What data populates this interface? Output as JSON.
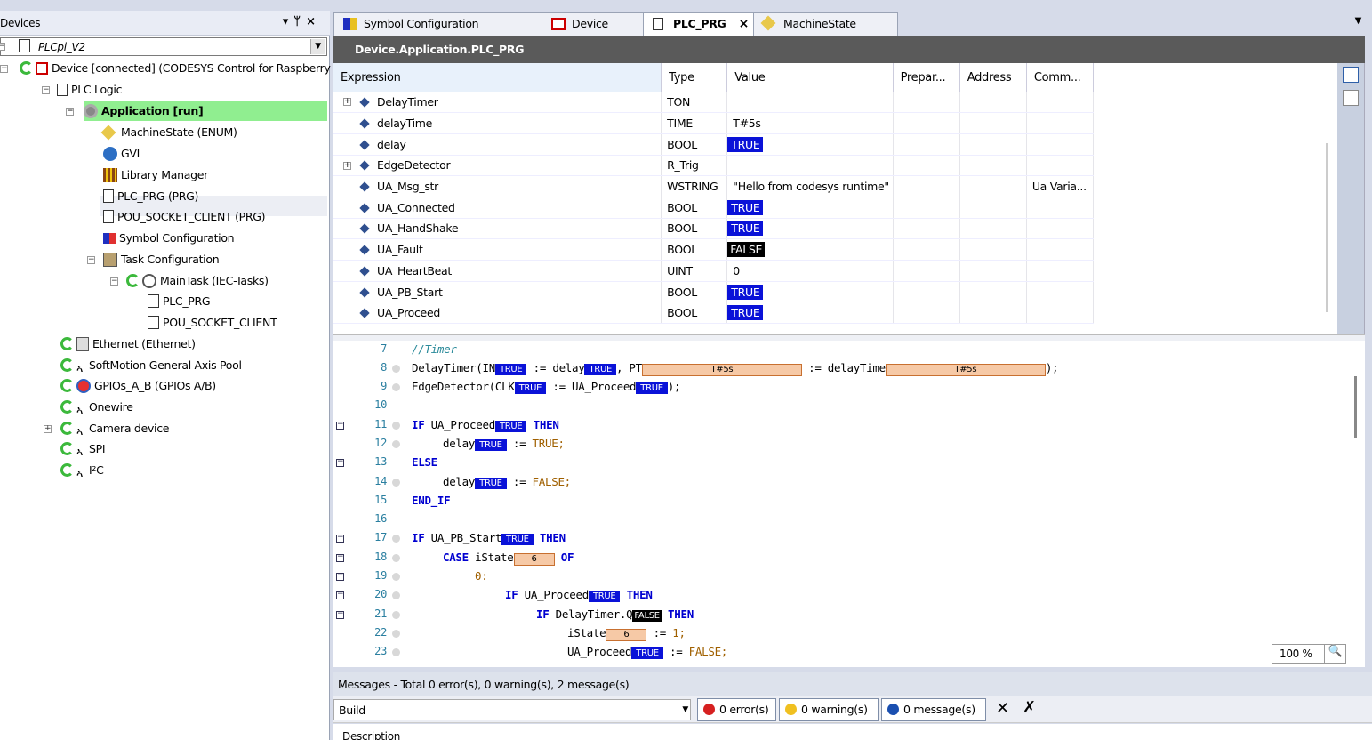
{
  "devices_panel": {
    "title": "Devices",
    "header_buttons": [
      "▾",
      "ᛘ",
      "×"
    ],
    "project_combo": "PLCpi_V2",
    "tree": [
      {
        "label": "Device [connected] (CODESYS Control for Raspberry",
        "level": 1
      },
      {
        "label": "PLC Logic",
        "level": 2
      },
      {
        "label": "Application [run]",
        "level": 3
      },
      {
        "label": "MachineState (ENUM)",
        "level": 4
      },
      {
        "label": "GVL",
        "level": 4
      },
      {
        "label": "Library Manager",
        "level": 4
      },
      {
        "label": "PLC_PRG (PRG)",
        "level": 4
      },
      {
        "label": "POU_SOCKET_CLIENT (PRG)",
        "level": 4
      },
      {
        "label": "Symbol Configuration",
        "level": 4
      },
      {
        "label": "Task Configuration",
        "level": 4
      },
      {
        "label": "MainTask (IEC-Tasks)",
        "level": 5
      },
      {
        "label": "PLC_PRG",
        "level": 6
      },
      {
        "label": "POU_SOCKET_CLIENT",
        "level": 6
      },
      {
        "label": "Ethernet (Ethernet)",
        "level": 2
      },
      {
        "label": "SoftMotion General Axis Pool",
        "level": 2
      },
      {
        "label": "GPIOs_A_B (GPIOs A/B)",
        "level": 2
      },
      {
        "label": "Onewire",
        "level": 2
      },
      {
        "label": "Camera device",
        "level": 2
      },
      {
        "label": "SPI",
        "level": 2
      },
      {
        "label": "I²C",
        "level": 2
      }
    ]
  },
  "tabs": [
    {
      "label": "Symbol Configuration"
    },
    {
      "label": "Device"
    },
    {
      "label": "PLC_PRG",
      "close": "×"
    },
    {
      "label": "MachineState"
    }
  ],
  "editor_path": "Device.Application.PLC_PRG",
  "watch": {
    "headers": [
      "Expression",
      "Type",
      "Value",
      "Prepar...",
      "Address",
      "Comm..."
    ],
    "rows": [
      {
        "expr": "DelayTimer",
        "type": "TON",
        "value": "",
        "comment": "",
        "expand": "+"
      },
      {
        "expr": "delayTime",
        "type": "TIME",
        "value": "T#5s",
        "comment": ""
      },
      {
        "expr": "delay",
        "type": "BOOL",
        "value": "TRUE",
        "comment": ""
      },
      {
        "expr": "EdgeDetector",
        "type": "R_Trig",
        "value": "",
        "comment": "",
        "expand": "+"
      },
      {
        "expr": "UA_Msg_str",
        "type": "WSTRING",
        "value": "\"Hello from codesys runtime\"",
        "comment": "Ua Varia..."
      },
      {
        "expr": "UA_Connected",
        "type": "BOOL",
        "value": "TRUE",
        "comment": ""
      },
      {
        "expr": "UA_HandShake",
        "type": "BOOL",
        "value": "TRUE",
        "comment": ""
      },
      {
        "expr": "UA_Fault",
        "type": "BOOL",
        "value": "FALSE",
        "comment": ""
      },
      {
        "expr": "UA_HeartBeat",
        "type": "UINT",
        "value": "0",
        "comment": ""
      },
      {
        "expr": "UA_PB_Start",
        "type": "BOOL",
        "value": "TRUE",
        "comment": ""
      },
      {
        "expr": "UA_Proceed",
        "type": "BOOL",
        "value": "TRUE",
        "comment": ""
      }
    ]
  },
  "code": {
    "line_numbers": [
      "7",
      "8",
      "9",
      "10",
      "11",
      "12",
      "13",
      "14",
      "15",
      "16",
      "17",
      "18",
      "19",
      "20",
      "21",
      "22",
      "23"
    ],
    "t": {
      "timer_comment": "//Timer",
      "delaytimer": "DelayTimer(IN",
      "assign": " := ",
      "delay": "delay",
      "pt": ", PT",
      "assign_delaytime": " := delayTime",
      "close_semicolon": ");",
      "edgedetector": "EdgeDetector(CLK",
      "ua_proceed": "UA_Proceed",
      "if": "IF",
      "then": "THEN",
      "ua_proceed_sp": " UA_Proceed",
      "true_kw": "TRUE;",
      "false_kw": "FALSE;",
      "else": "ELSE",
      "end_if": "END_IF",
      "ua_pb_start": " UA_PB_Start",
      "case": "CASE",
      "istate": " iState",
      "of": "OF",
      "zero": "0:",
      "delaytimer_q": " DelayTimer.Q",
      "istate_plain": "iState",
      "one": "1;",
      "ua_proceed_plain": "UA_Proceed"
    },
    "monitor": {
      "true": "TRUE",
      "false": "FALSE",
      "t5s": "T#5s",
      "six": "6"
    }
  },
  "zoom": "100 %",
  "messages": {
    "title": "Messages - Total 0 error(s), 0 warning(s), 2 message(s)",
    "build": "Build",
    "errors": "0 error(s)",
    "warnings": "0 warning(s)",
    "messages": "0 message(s)",
    "description": "Description"
  },
  "colors": {
    "monitor_true": "#0a12d8",
    "monitor_false": "#000000",
    "run_green": "#3cb93c",
    "app_highlight": "#90ee90"
  }
}
